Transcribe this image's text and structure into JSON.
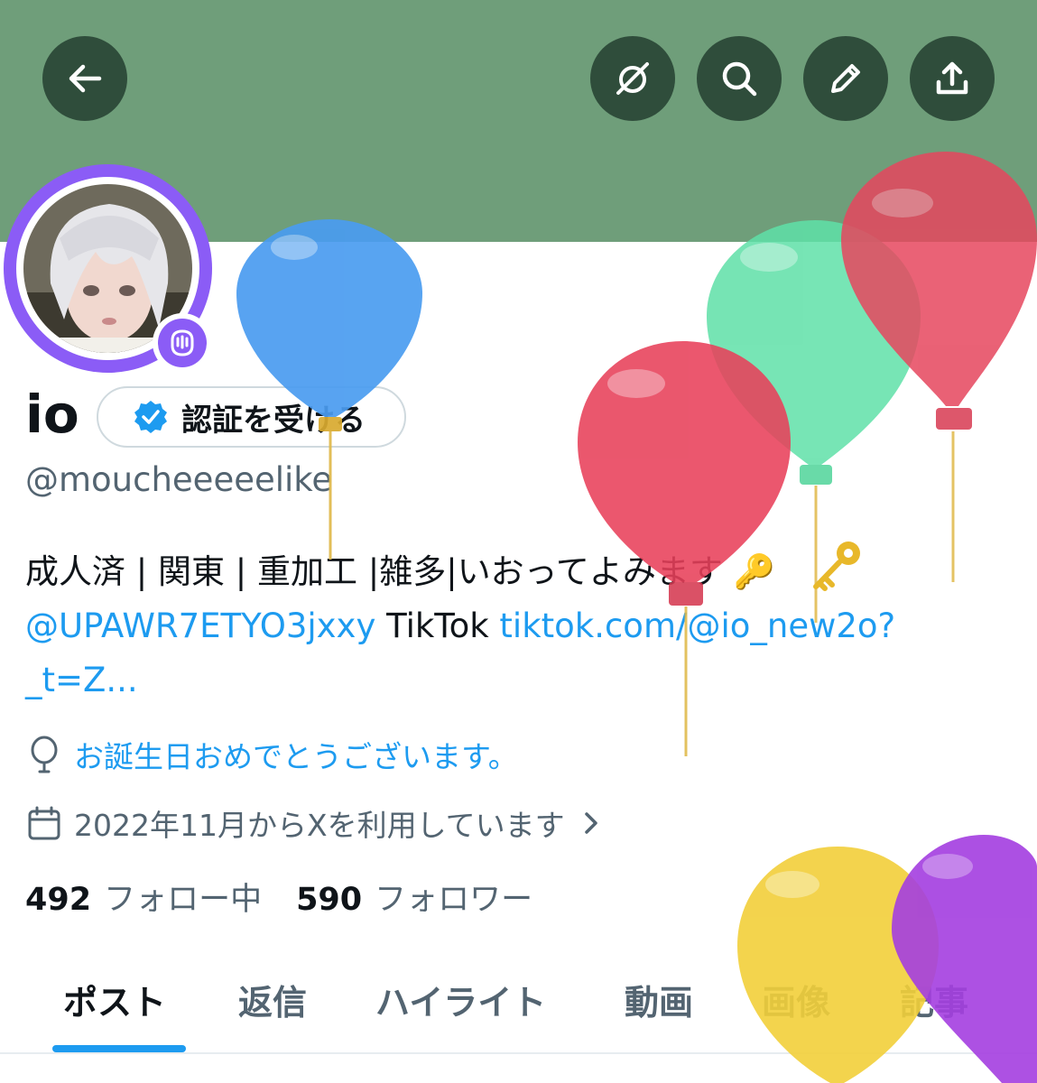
{
  "header": {
    "back_icon": "arrow-left-icon",
    "actions": [
      "grok-icon",
      "search-icon",
      "pencil-icon",
      "share-icon"
    ]
  },
  "profile": {
    "name": "io",
    "verify_label": "認証を受ける",
    "handle": "@moucheeeeelike",
    "bio_line1": "成人済 | 関東 | 重加工 |雑多|いおってよみます 🔑",
    "bio_mention": "@UPAWR7ETYO3jxxy",
    "bio_tiktok": " TikTok ",
    "bio_link_a": "tiktok.com/@io_new2o?",
    "bio_link_b": "_t=Z...",
    "birthday": "お誕生日おめでとうございます。",
    "joined": "2022年11月からXを利用しています"
  },
  "stats": {
    "following_count": "492",
    "following_label": "フォロー中",
    "followers_count": "590",
    "followers_label": "フォロワー"
  },
  "tabs": [
    "ポスト",
    "返信",
    "ハイライト",
    "動画",
    "画像",
    "記事"
  ],
  "colors": {
    "banner": "#6f9e7a",
    "accent": "#1d9bf0",
    "ring": "#8b5cf6"
  }
}
